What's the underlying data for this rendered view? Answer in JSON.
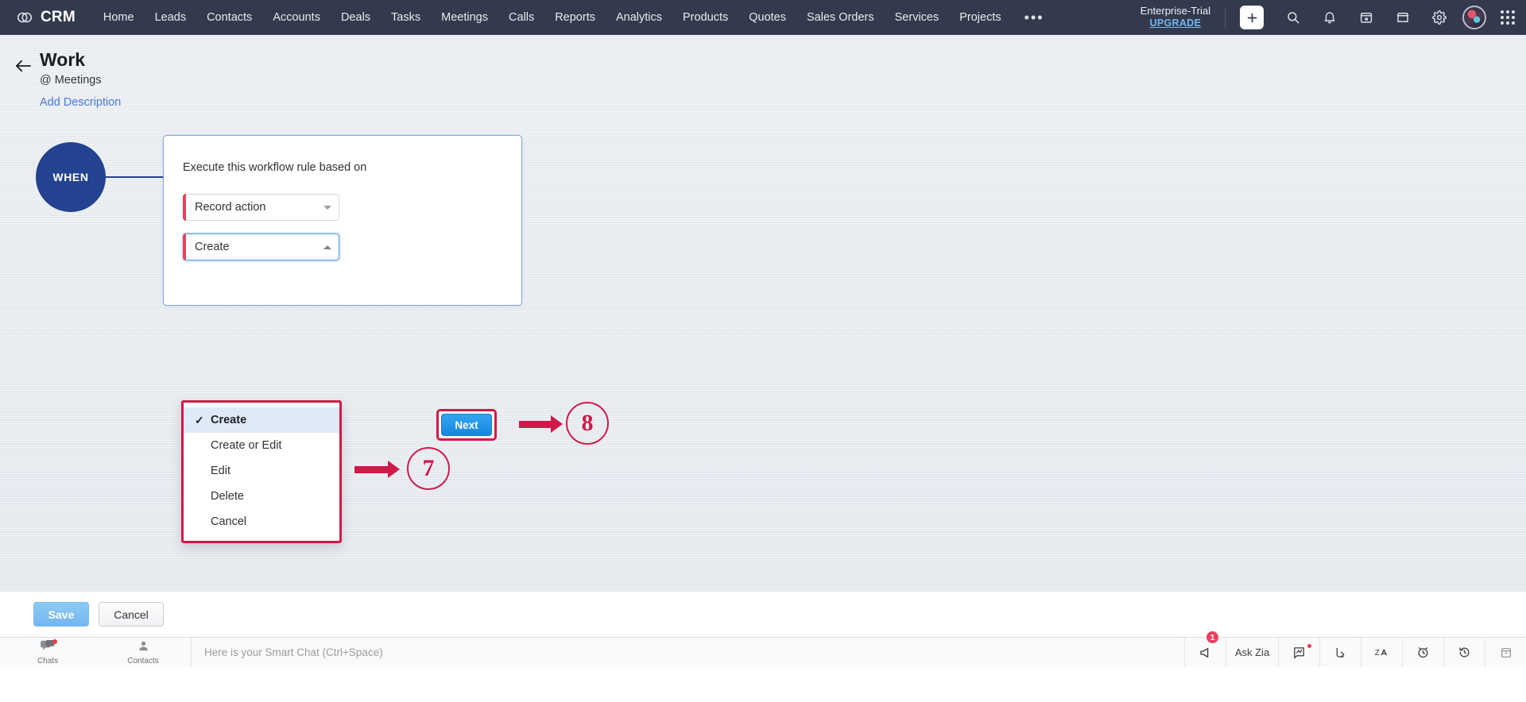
{
  "topnav": {
    "brand": "CRM",
    "brand_icon": "zoho-crm-logo-icon",
    "items": [
      {
        "label": "Home"
      },
      {
        "label": "Leads"
      },
      {
        "label": "Contacts"
      },
      {
        "label": "Accounts"
      },
      {
        "label": "Deals"
      },
      {
        "label": "Tasks"
      },
      {
        "label": "Meetings"
      },
      {
        "label": "Calls"
      },
      {
        "label": "Reports"
      },
      {
        "label": "Analytics"
      },
      {
        "label": "Products"
      },
      {
        "label": "Quotes"
      },
      {
        "label": "Sales Orders"
      },
      {
        "label": "Services"
      },
      {
        "label": "Projects"
      }
    ],
    "more_label": "•••",
    "trial_label": "Enterprise-Trial",
    "trial_upgrade": "UPGRADE",
    "icons": [
      "plus-icon",
      "search-icon",
      "bell-icon",
      "calendar-icon",
      "store-icon",
      "gear-icon",
      "avatar",
      "apps-grid-icon"
    ]
  },
  "header": {
    "back_icon": "back-arrow-icon",
    "title": "Work",
    "subtitle": "@ Meetings",
    "description_link": "Add Description"
  },
  "flow": {
    "when_label": "WHEN",
    "card": {
      "prompt": "Execute this workflow rule based on",
      "field_trigger_type": "Record action",
      "field_action": "Create",
      "next_label": "Next"
    },
    "dropdown": {
      "selected": "Create",
      "options": [
        {
          "label": "Create",
          "selected": true
        },
        {
          "label": "Create or Edit",
          "selected": false
        },
        {
          "label": "Edit",
          "selected": false
        },
        {
          "label": "Delete",
          "selected": false
        },
        {
          "label": "Cancel",
          "selected": false
        }
      ]
    },
    "annotations": [
      {
        "number": "7"
      },
      {
        "number": "8"
      }
    ]
  },
  "actionbar": {
    "save_label": "Save",
    "cancel_label": "Cancel"
  },
  "statusbar": {
    "chats_label": "Chats",
    "contacts_label": "Contacts",
    "chat_placeholder": "Here is your Smart Chat (Ctrl+Space)",
    "announce_badge": "1",
    "ask_zia_label": "Ask Zia",
    "right_icons": [
      "megaphone-icon",
      "ask-zia",
      "chart-icon",
      "share-icon",
      "translate-icon",
      "alarm-clock-icon",
      "history-icon",
      "archive-icon"
    ]
  },
  "colors": {
    "navbar": "#343a4d",
    "when_circle": "#23428f",
    "accent_red": "#e8415c",
    "annotation_red": "#cf1a49",
    "primary_blue": "#1488e0",
    "link_blue": "#4a7ad4"
  }
}
